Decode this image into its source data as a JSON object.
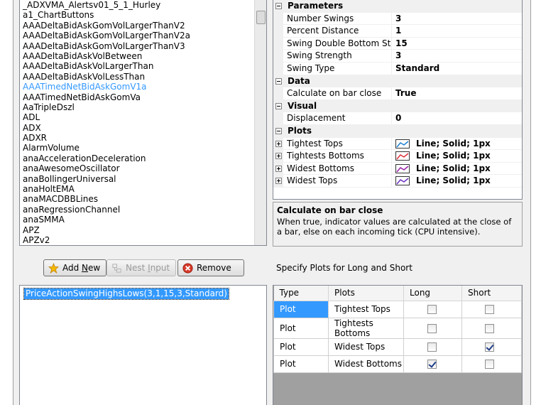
{
  "indicators": [
    "_ADXVMA_Alertsv01_5_1_Hurley",
    "a1_ChartButtons",
    "AAADeltaBidAskGomVolLargerThanV2",
    "AAADeltaBidAskGomVolLargerThanV2a",
    "AAADeltaBidAskGomVolLargerThanV3",
    "AAADeltaBidAskVolBetween",
    "AAADeltaBidAskVolLargerThan",
    "AAADeltaBidAskVolLessThan",
    "AAATimedNetBidAskGomV1a",
    "AAATimedNetBidAskGomVa",
    "AaTripleDszl",
    "ADL",
    "ADX",
    "ADXR",
    "AlarmVolume",
    "anaAccelerationDeceleration",
    "anaAwesomeOscillator",
    "anaBollingerUniversal",
    "anaHoltEMA",
    "anaMACDBBLines",
    "anaRegressionChannel",
    "anaSMMA",
    "APZ",
    "APZv2"
  ],
  "selected_indicator_index": 8,
  "property_grid": {
    "parameters": {
      "label": "Parameters",
      "rows": [
        {
          "name": "Number Swings",
          "value": "3"
        },
        {
          "name": "Percent Distance",
          "value": "1"
        },
        {
          "name": "Swing Double Bottom Stren",
          "value": "15"
        },
        {
          "name": "Swing Strength",
          "value": "3"
        },
        {
          "name": "Swing Type",
          "value": "Standard"
        }
      ]
    },
    "data": {
      "label": "Data",
      "rows": [
        {
          "name": "Calculate on bar close",
          "value": "True"
        }
      ]
    },
    "visual": {
      "label": "Visual",
      "rows": [
        {
          "name": "Displacement",
          "value": "0"
        }
      ]
    },
    "plots": {
      "label": "Plots",
      "rows": [
        {
          "name": "Tightest Tops",
          "value": "Line; Solid; 1px",
          "color": "#1e7fd0"
        },
        {
          "name": "Tightests Bottoms",
          "value": "Line; Solid; 1px",
          "color": "#e0303a"
        },
        {
          "name": "Widest Bottoms",
          "value": "Line; Solid; 1px",
          "color": "#9a1fa8"
        },
        {
          "name": "Widest Tops",
          "value": "Line; Solid; 1px",
          "color": "#6a2fc0"
        }
      ]
    }
  },
  "description": {
    "title": "Calculate on bar close",
    "text": "When true, indicator values are calculated at the close of a bar, else on each incoming tick (CPU intensive)."
  },
  "buttons": {
    "add_new_prefix": "Add ",
    "add_new_underlined": "N",
    "add_new_suffix": "ew",
    "nest_input_prefix": "Nest ",
    "nest_input_underlined": "I",
    "nest_input_suffix": "nput",
    "remove": "Remove"
  },
  "specify_plots_label": "Specify Plots for Long and Short",
  "selected_list": [
    "PriceActionSwingHighsLows(3,1,15,3,Standard)"
  ],
  "plots_table": {
    "headers": [
      "Type",
      "Plots",
      "Long",
      "Short"
    ],
    "rows": [
      {
        "type": "Plot",
        "plot": "Tightest Tops",
        "long": false,
        "short": false
      },
      {
        "type": "Plot",
        "plot": "Tightests Bottoms",
        "long": false,
        "short": false
      },
      {
        "type": "Plot",
        "plot": "Widest Tops",
        "long": false,
        "short": true
      },
      {
        "type": "Plot",
        "plot": "Widest Bottoms",
        "long": true,
        "short": false
      }
    ]
  }
}
